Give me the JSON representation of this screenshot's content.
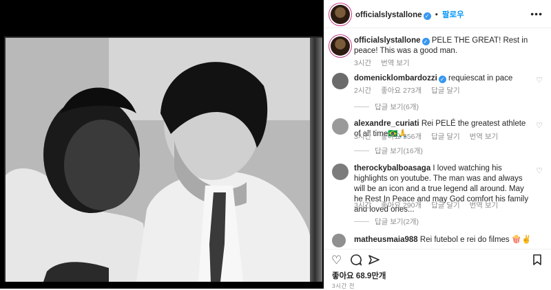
{
  "post": {
    "username": "officialslystallone",
    "follow_label": "팔로우",
    "more_icon": "more-horizontal-icon"
  },
  "caption": {
    "username": "officialslystallone",
    "text": "PELE THE GREAT! Rest in peace! This was a good man.",
    "time": "3시간",
    "translate": "번역 보기"
  },
  "comments": [
    {
      "username": "domenicklombardozzi",
      "verified": true,
      "text": "requiescat in pace",
      "time": "2시간",
      "likes": "좋아요 273개",
      "reply": "답글 달기",
      "view_replies": "답글 보기(6개)"
    },
    {
      "username": "alexandre_curiati",
      "verified": false,
      "text": "Rei PELÉ the greatest athlete of all time🇧🇷🙏",
      "time": "3시간",
      "likes": "좋아요 556개",
      "reply": "답글 달기",
      "translate": "번역 보기",
      "view_replies": "답글 보기(16개)"
    },
    {
      "username": "therockybalboasaga",
      "verified": false,
      "text": "I loved watching his highlights on youtube. The man was and always will be an icon and a true legend all around. May he Rest In Peace and may God comfort his family and loved ones...",
      "time": "3시간",
      "likes": "좋아요 290개",
      "reply": "답글 달기",
      "translate": "번역 보기",
      "view_replies": "답글 보기(2개)"
    },
    {
      "username": "matheusmaia988",
      "verified": false,
      "text": "Rei futebol e rei do filmes 🍿✌️"
    }
  ],
  "actions": {
    "like_icon": "heart-icon",
    "comment_icon": "comment-icon",
    "share_icon": "send-icon",
    "save_icon": "bookmark-icon"
  },
  "footer": {
    "likes": "좋아요 68.9만개",
    "time": "3시간 전"
  }
}
